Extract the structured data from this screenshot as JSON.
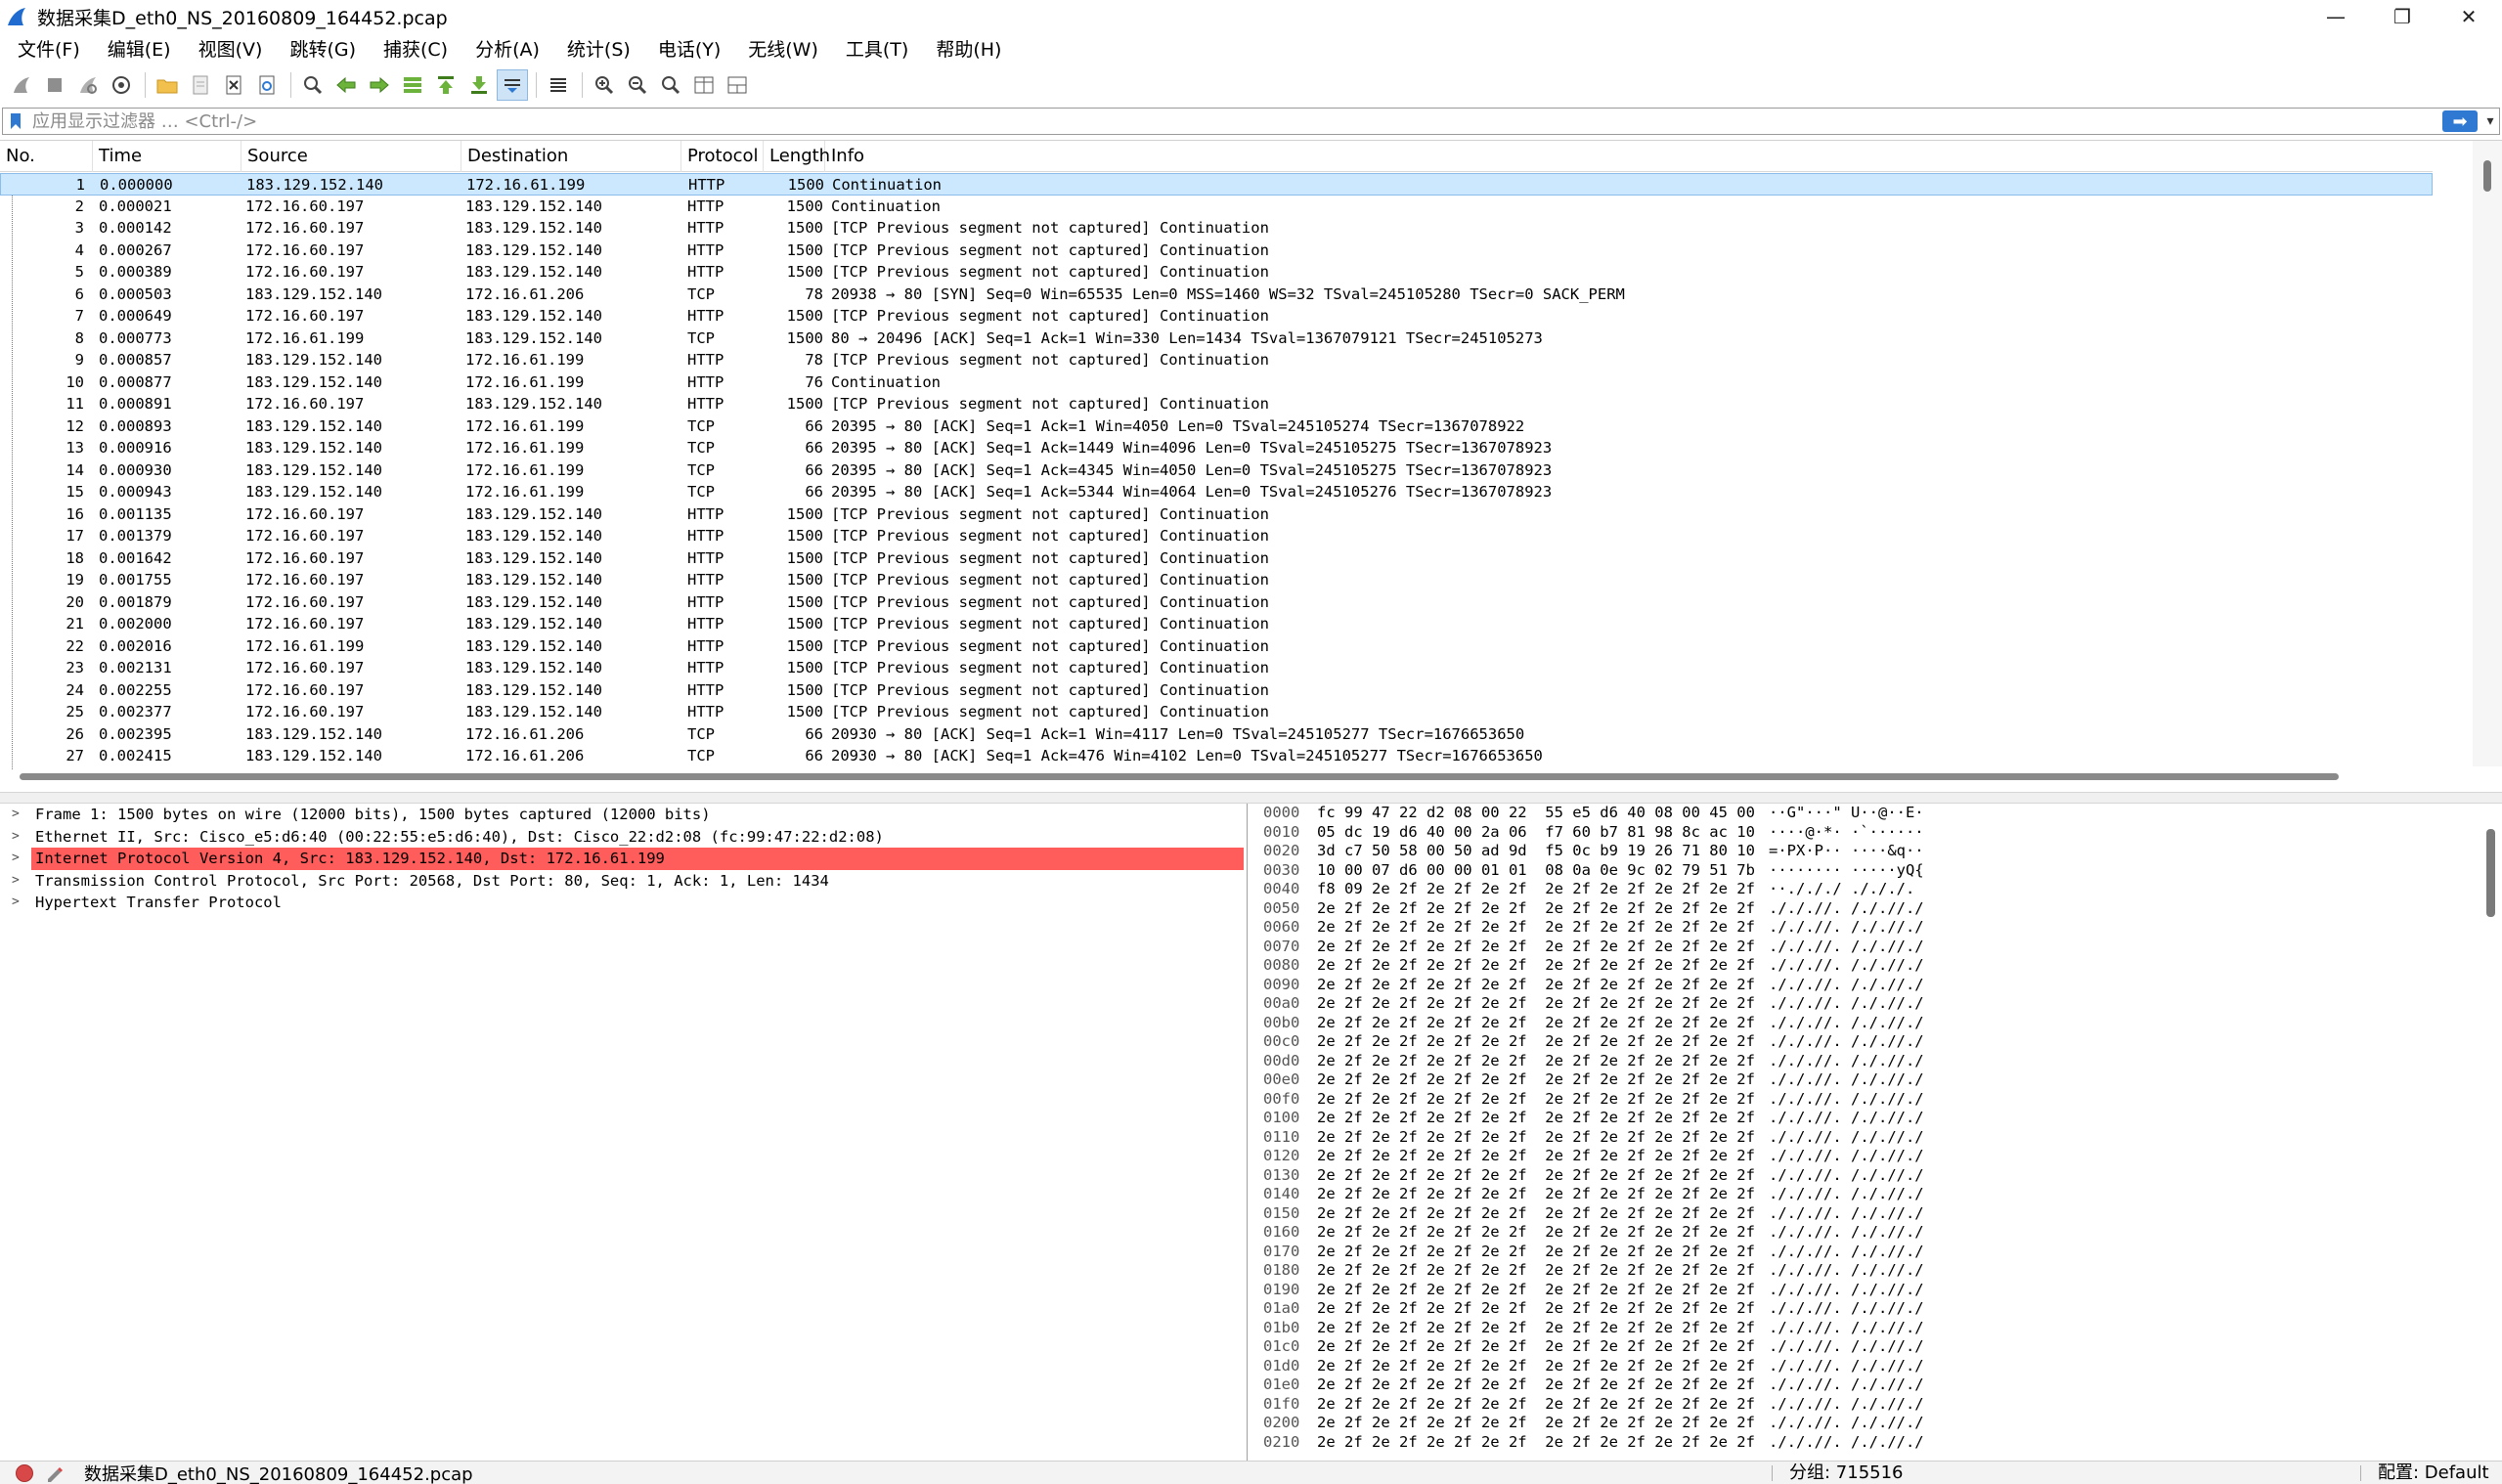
{
  "window": {
    "title": "数据采集D_eth0_NS_20160809_164452.pcap",
    "minimize": "—",
    "maximize": "❐",
    "close": "✕"
  },
  "menu": [
    "文件(F)",
    "编辑(E)",
    "视图(V)",
    "跳转(G)",
    "捕获(C)",
    "分析(A)",
    "统计(S)",
    "电话(Y)",
    "无线(W)",
    "工具(T)",
    "帮助(H)"
  ],
  "toolbar": {
    "icons": [
      "shark-fin-start-icon",
      "stop-capture-icon",
      "restart-capture-icon",
      "capture-options-icon",
      "open-file-icon",
      "save-file-icon",
      "close-file-icon",
      "reload-file-icon",
      "find-packet-icon",
      "go-back-icon",
      "go-forward-icon",
      "go-to-packet-icon",
      "go-first-icon",
      "go-last-icon",
      "auto-scroll-icon",
      "colorize-icon",
      "zoom-in-icon",
      "zoom-out-icon",
      "zoom-normal-icon",
      "resize-columns-icon",
      "layout-icon"
    ]
  },
  "filter": {
    "placeholder": "应用显示过滤器 … <Ctrl-/>",
    "apply_glyph": "➡",
    "dropdown_glyph": "▾",
    "add_glyph": "+"
  },
  "packet_list": {
    "columns": [
      "No.",
      "Time",
      "Source",
      "Destination",
      "Protocol",
      "Length",
      "Info"
    ],
    "rows": [
      {
        "no": "1",
        "time": "0.000000",
        "src": "183.129.152.140",
        "dst": "172.16.61.199",
        "proto": "HTTP",
        "len": "1500",
        "info": "Continuation"
      },
      {
        "no": "2",
        "time": "0.000021",
        "src": "172.16.60.197",
        "dst": "183.129.152.140",
        "proto": "HTTP",
        "len": "1500",
        "info": "Continuation"
      },
      {
        "no": "3",
        "time": "0.000142",
        "src": "172.16.60.197",
        "dst": "183.129.152.140",
        "proto": "HTTP",
        "len": "1500",
        "info": "[TCP Previous segment not captured] Continuation"
      },
      {
        "no": "4",
        "time": "0.000267",
        "src": "172.16.60.197",
        "dst": "183.129.152.140",
        "proto": "HTTP",
        "len": "1500",
        "info": "[TCP Previous segment not captured] Continuation"
      },
      {
        "no": "5",
        "time": "0.000389",
        "src": "172.16.60.197",
        "dst": "183.129.152.140",
        "proto": "HTTP",
        "len": "1500",
        "info": "[TCP Previous segment not captured] Continuation"
      },
      {
        "no": "6",
        "time": "0.000503",
        "src": "183.129.152.140",
        "dst": "172.16.61.206",
        "proto": "TCP",
        "len": "78",
        "info": "20938 → 80 [SYN] Seq=0 Win=65535 Len=0 MSS=1460 WS=32 TSval=245105280 TSecr=0 SACK_PERM"
      },
      {
        "no": "7",
        "time": "0.000649",
        "src": "172.16.60.197",
        "dst": "183.129.152.140",
        "proto": "HTTP",
        "len": "1500",
        "info": "[TCP Previous segment not captured] Continuation"
      },
      {
        "no": "8",
        "time": "0.000773",
        "src": "172.16.61.199",
        "dst": "183.129.152.140",
        "proto": "TCP",
        "len": "1500",
        "info": "80 → 20496 [ACK] Seq=1 Ack=1 Win=330 Len=1434 TSval=1367079121 TSecr=245105273"
      },
      {
        "no": "9",
        "time": "0.000857",
        "src": "183.129.152.140",
        "dst": "172.16.61.199",
        "proto": "HTTP",
        "len": "78",
        "info": "[TCP Previous segment not captured] Continuation"
      },
      {
        "no": "10",
        "time": "0.000877",
        "src": "183.129.152.140",
        "dst": "172.16.61.199",
        "proto": "HTTP",
        "len": "76",
        "info": "Continuation"
      },
      {
        "no": "11",
        "time": "0.000891",
        "src": "172.16.60.197",
        "dst": "183.129.152.140",
        "proto": "HTTP",
        "len": "1500",
        "info": "[TCP Previous segment not captured] Continuation"
      },
      {
        "no": "12",
        "time": "0.000893",
        "src": "183.129.152.140",
        "dst": "172.16.61.199",
        "proto": "TCP",
        "len": "66",
        "info": "20395 → 80 [ACK] Seq=1 Ack=1 Win=4050 Len=0 TSval=245105274 TSecr=1367078922"
      },
      {
        "no": "13",
        "time": "0.000916",
        "src": "183.129.152.140",
        "dst": "172.16.61.199",
        "proto": "TCP",
        "len": "66",
        "info": "20395 → 80 [ACK] Seq=1 Ack=1449 Win=4096 Len=0 TSval=245105275 TSecr=1367078923"
      },
      {
        "no": "14",
        "time": "0.000930",
        "src": "183.129.152.140",
        "dst": "172.16.61.199",
        "proto": "TCP",
        "len": "66",
        "info": "20395 → 80 [ACK] Seq=1 Ack=4345 Win=4050 Len=0 TSval=245105275 TSecr=1367078923"
      },
      {
        "no": "15",
        "time": "0.000943",
        "src": "183.129.152.140",
        "dst": "172.16.61.199",
        "proto": "TCP",
        "len": "66",
        "info": "20395 → 80 [ACK] Seq=1 Ack=5344 Win=4064 Len=0 TSval=245105276 TSecr=1367078923"
      },
      {
        "no": "16",
        "time": "0.001135",
        "src": "172.16.60.197",
        "dst": "183.129.152.140",
        "proto": "HTTP",
        "len": "1500",
        "info": "[TCP Previous segment not captured] Continuation"
      },
      {
        "no": "17",
        "time": "0.001379",
        "src": "172.16.60.197",
        "dst": "183.129.152.140",
        "proto": "HTTP",
        "len": "1500",
        "info": "[TCP Previous segment not captured] Continuation"
      },
      {
        "no": "18",
        "time": "0.001642",
        "src": "172.16.60.197",
        "dst": "183.129.152.140",
        "proto": "HTTP",
        "len": "1500",
        "info": "[TCP Previous segment not captured] Continuation"
      },
      {
        "no": "19",
        "time": "0.001755",
        "src": "172.16.60.197",
        "dst": "183.129.152.140",
        "proto": "HTTP",
        "len": "1500",
        "info": "[TCP Previous segment not captured] Continuation"
      },
      {
        "no": "20",
        "time": "0.001879",
        "src": "172.16.60.197",
        "dst": "183.129.152.140",
        "proto": "HTTP",
        "len": "1500",
        "info": "[TCP Previous segment not captured] Continuation"
      },
      {
        "no": "21",
        "time": "0.002000",
        "src": "172.16.60.197",
        "dst": "183.129.152.140",
        "proto": "HTTP",
        "len": "1500",
        "info": "[TCP Previous segment not captured] Continuation"
      },
      {
        "no": "22",
        "time": "0.002016",
        "src": "172.16.61.199",
        "dst": "183.129.152.140",
        "proto": "HTTP",
        "len": "1500",
        "info": "[TCP Previous segment not captured] Continuation"
      },
      {
        "no": "23",
        "time": "0.002131",
        "src": "172.16.60.197",
        "dst": "183.129.152.140",
        "proto": "HTTP",
        "len": "1500",
        "info": "[TCP Previous segment not captured] Continuation"
      },
      {
        "no": "24",
        "time": "0.002255",
        "src": "172.16.60.197",
        "dst": "183.129.152.140",
        "proto": "HTTP",
        "len": "1500",
        "info": "[TCP Previous segment not captured] Continuation"
      },
      {
        "no": "25",
        "time": "0.002377",
        "src": "172.16.60.197",
        "dst": "183.129.152.140",
        "proto": "HTTP",
        "len": "1500",
        "info": "[TCP Previous segment not captured] Continuation"
      },
      {
        "no": "26",
        "time": "0.002395",
        "src": "183.129.152.140",
        "dst": "172.16.61.206",
        "proto": "TCP",
        "len": "66",
        "info": "20930 → 80 [ACK] Seq=1 Ack=1 Win=4117 Len=0 TSval=245105277 TSecr=1676653650"
      },
      {
        "no": "27",
        "time": "0.002415",
        "src": "183.129.152.140",
        "dst": "172.16.61.206",
        "proto": "TCP",
        "len": "66",
        "info": "20930 → 80 [ACK] Seq=1 Ack=476 Win=4102 Len=0 TSval=245105277 TSecr=1676653650"
      }
    ]
  },
  "details": {
    "rows": [
      {
        "text": "Frame 1: 1500 bytes on wire (12000 bits), 1500 bytes captured (12000 bits)",
        "highlight": false
      },
      {
        "text": "Ethernet II, Src: Cisco_e5:d6:40 (00:22:55:e5:d6:40), Dst: Cisco_22:d2:08 (fc:99:47:22:d2:08)",
        "highlight": false
      },
      {
        "text": "Internet Protocol Version 4, Src: 183.129.152.140, Dst: 172.16.61.199",
        "highlight": true
      },
      {
        "text": "Transmission Control Protocol, Src Port: 20568, Dst Port: 80, Seq: 1, Ack: 1, Len: 1434",
        "highlight": false
      },
      {
        "text": "Hypertext Transfer Protocol",
        "highlight": false
      }
    ],
    "expand_glyph": ">",
    "highlight_color": "#ff5c5c"
  },
  "bytes": {
    "rows": [
      {
        "off": "0000",
        "hex": "fc 99 47 22 d2 08 00 22  55 e5 d6 40 08 00 45 00",
        "asc": "··G\"···\" U··@··E·"
      },
      {
        "off": "0010",
        "hex": "05 dc 19 d6 40 00 2a 06  f7 60 b7 81 98 8c ac 10",
        "asc": "····@·*· ·`······"
      },
      {
        "off": "0020",
        "hex": "3d c7 50 58 00 50 ad 9d  f5 0c b9 19 26 71 80 10",
        "asc": "=·PX·P·· ····&q··"
      },
      {
        "off": "0030",
        "hex": "10 00 07 d6 00 00 01 01  08 0a 0e 9c 02 79 51 7b",
        "asc": "········ ·····yQ{"
      },
      {
        "off": "0040",
        "hex": "f8 09 2e 2f 2e 2f 2e 2f  2e 2f 2e 2f 2e 2f 2e 2f",
        "asc": "··./././ ./././."
      },
      {
        "off": "0050",
        "hex": "2e 2f 2e 2f 2e 2f 2e 2f  2e 2f 2e 2f 2e 2f 2e 2f",
        "asc": "./././/. /././/./"
      },
      {
        "off": "0060",
        "hex": "2e 2f 2e 2f 2e 2f 2e 2f  2e 2f 2e 2f 2e 2f 2e 2f",
        "asc": "./././/. /././/./"
      },
      {
        "off": "0070",
        "hex": "2e 2f 2e 2f 2e 2f 2e 2f  2e 2f 2e 2f 2e 2f 2e 2f",
        "asc": "./././/. /././/./"
      },
      {
        "off": "0080",
        "hex": "2e 2f 2e 2f 2e 2f 2e 2f  2e 2f 2e 2f 2e 2f 2e 2f",
        "asc": "./././/. /././/./"
      },
      {
        "off": "0090",
        "hex": "2e 2f 2e 2f 2e 2f 2e 2f  2e 2f 2e 2f 2e 2f 2e 2f",
        "asc": "./././/. /././/./"
      },
      {
        "off": "00a0",
        "hex": "2e 2f 2e 2f 2e 2f 2e 2f  2e 2f 2e 2f 2e 2f 2e 2f",
        "asc": "./././/. /././/./"
      },
      {
        "off": "00b0",
        "hex": "2e 2f 2e 2f 2e 2f 2e 2f  2e 2f 2e 2f 2e 2f 2e 2f",
        "asc": "./././/. /././/./"
      },
      {
        "off": "00c0",
        "hex": "2e 2f 2e 2f 2e 2f 2e 2f  2e 2f 2e 2f 2e 2f 2e 2f",
        "asc": "./././/. /././/./"
      },
      {
        "off": "00d0",
        "hex": "2e 2f 2e 2f 2e 2f 2e 2f  2e 2f 2e 2f 2e 2f 2e 2f",
        "asc": "./././/. /././/./"
      },
      {
        "off": "00e0",
        "hex": "2e 2f 2e 2f 2e 2f 2e 2f  2e 2f 2e 2f 2e 2f 2e 2f",
        "asc": "./././/. /././/./"
      },
      {
        "off": "00f0",
        "hex": "2e 2f 2e 2f 2e 2f 2e 2f  2e 2f 2e 2f 2e 2f 2e 2f",
        "asc": "./././/. /././/./"
      },
      {
        "off": "0100",
        "hex": "2e 2f 2e 2f 2e 2f 2e 2f  2e 2f 2e 2f 2e 2f 2e 2f",
        "asc": "./././/. /././/./"
      },
      {
        "off": "0110",
        "hex": "2e 2f 2e 2f 2e 2f 2e 2f  2e 2f 2e 2f 2e 2f 2e 2f",
        "asc": "./././/. /././/./"
      },
      {
        "off": "0120",
        "hex": "2e 2f 2e 2f 2e 2f 2e 2f  2e 2f 2e 2f 2e 2f 2e 2f",
        "asc": "./././/. /././/./"
      },
      {
        "off": "0130",
        "hex": "2e 2f 2e 2f 2e 2f 2e 2f  2e 2f 2e 2f 2e 2f 2e 2f",
        "asc": "./././/. /././/./"
      },
      {
        "off": "0140",
        "hex": "2e 2f 2e 2f 2e 2f 2e 2f  2e 2f 2e 2f 2e 2f 2e 2f",
        "asc": "./././/. /././/./"
      },
      {
        "off": "0150",
        "hex": "2e 2f 2e 2f 2e 2f 2e 2f  2e 2f 2e 2f 2e 2f 2e 2f",
        "asc": "./././/. /././/./"
      },
      {
        "off": "0160",
        "hex": "2e 2f 2e 2f 2e 2f 2e 2f  2e 2f 2e 2f 2e 2f 2e 2f",
        "asc": "./././/. /././/./"
      },
      {
        "off": "0170",
        "hex": "2e 2f 2e 2f 2e 2f 2e 2f  2e 2f 2e 2f 2e 2f 2e 2f",
        "asc": "./././/. /././/./"
      },
      {
        "off": "0180",
        "hex": "2e 2f 2e 2f 2e 2f 2e 2f  2e 2f 2e 2f 2e 2f 2e 2f",
        "asc": "./././/. /././/./"
      },
      {
        "off": "0190",
        "hex": "2e 2f 2e 2f 2e 2f 2e 2f  2e 2f 2e 2f 2e 2f 2e 2f",
        "asc": "./././/. /././/./"
      },
      {
        "off": "01a0",
        "hex": "2e 2f 2e 2f 2e 2f 2e 2f  2e 2f 2e 2f 2e 2f 2e 2f",
        "asc": "./././/. /././/./"
      },
      {
        "off": "01b0",
        "hex": "2e 2f 2e 2f 2e 2f 2e 2f  2e 2f 2e 2f 2e 2f 2e 2f",
        "asc": "./././/. /././/./"
      },
      {
        "off": "01c0",
        "hex": "2e 2f 2e 2f 2e 2f 2e 2f  2e 2f 2e 2f 2e 2f 2e 2f",
        "asc": "./././/. /././/./"
      },
      {
        "off": "01d0",
        "hex": "2e 2f 2e 2f 2e 2f 2e 2f  2e 2f 2e 2f 2e 2f 2e 2f",
        "asc": "./././/. /././/./"
      },
      {
        "off": "01e0",
        "hex": "2e 2f 2e 2f 2e 2f 2e 2f  2e 2f 2e 2f 2e 2f 2e 2f",
        "asc": "./././/. /././/./"
      },
      {
        "off": "01f0",
        "hex": "2e 2f 2e 2f 2e 2f 2e 2f  2e 2f 2e 2f 2e 2f 2e 2f",
        "asc": "./././/. /././/./"
      },
      {
        "off": "0200",
        "hex": "2e 2f 2e 2f 2e 2f 2e 2f  2e 2f 2e 2f 2e 2f 2e 2f",
        "asc": "./././/. /././/./"
      },
      {
        "off": "0210",
        "hex": "2e 2f 2e 2f 2e 2f 2e 2f  2e 2f 2e 2f 2e 2f 2e 2f",
        "asc": "./././/. /././/./"
      }
    ]
  },
  "status": {
    "file": "数据采集D_eth0_NS_20160809_164452.pcap",
    "packets": "分组: 715516",
    "profile": "配置: Default",
    "led_color": "#d94848"
  },
  "colors": {
    "selected_row": "#cce8ff",
    "accent": "#2f79d3"
  }
}
